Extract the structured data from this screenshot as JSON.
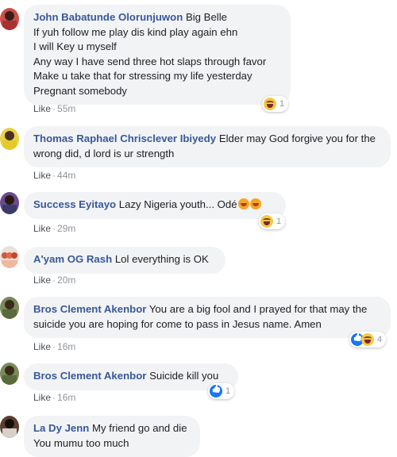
{
  "comments": [
    {
      "author": "John Babatunde Olorunjuwon",
      "text": "Big Belle\nIf yuh follow me play dis kind play again ehn\nI will Key u myself\nAny way I have send three hot slaps through favor\nMake u take that for stressing my life yesterday\nPregnant somebody",
      "like_label": "Like",
      "time": "55m",
      "reaction_count": "1",
      "reaction_icons": [
        "haha-icon"
      ]
    },
    {
      "author": "Thomas Raphael Chrisclever Ibiyedy",
      "text": "Elder may God forgive you for the wrong did, d lord is ur strength",
      "like_label": "Like",
      "time": "44m"
    },
    {
      "author": "Success Eyitayo",
      "text": "Lazy Nigeria youth... Odé",
      "like_label": "Like",
      "time": "29m",
      "reaction_count": "1",
      "reaction_icons": [
        "haha-icon"
      ]
    },
    {
      "author": "A'yam OG Rash",
      "text": "Lol everything is OK",
      "like_label": "Like",
      "time": "20m"
    },
    {
      "author": "Bros Clement Akenbor",
      "text": "You are a big fool and I prayed for that may the suicide you are hoping for come to pass in Jesus name. Amen",
      "like_label": "Like",
      "time": "16m",
      "reaction_count": "4",
      "reaction_icons": [
        "like-icon",
        "haha-icon"
      ]
    },
    {
      "author": "Bros Clement Akenbor",
      "text": "Suicide kill you",
      "like_label": "Like",
      "time": "16m",
      "reaction_count": "1",
      "reaction_icons": [
        "like-icon"
      ]
    },
    {
      "author": "La Dy Jenn",
      "text": "My friend go and die\nYou mumu too much",
      "like_label": "Like",
      "time": ""
    }
  ],
  "colors": {
    "author_link": "#385898",
    "bubble_bg": "#f2f3f5",
    "meta_text": "#90949c",
    "like_blue": "#1877f2",
    "haha_yellow": "#f7c74a"
  }
}
